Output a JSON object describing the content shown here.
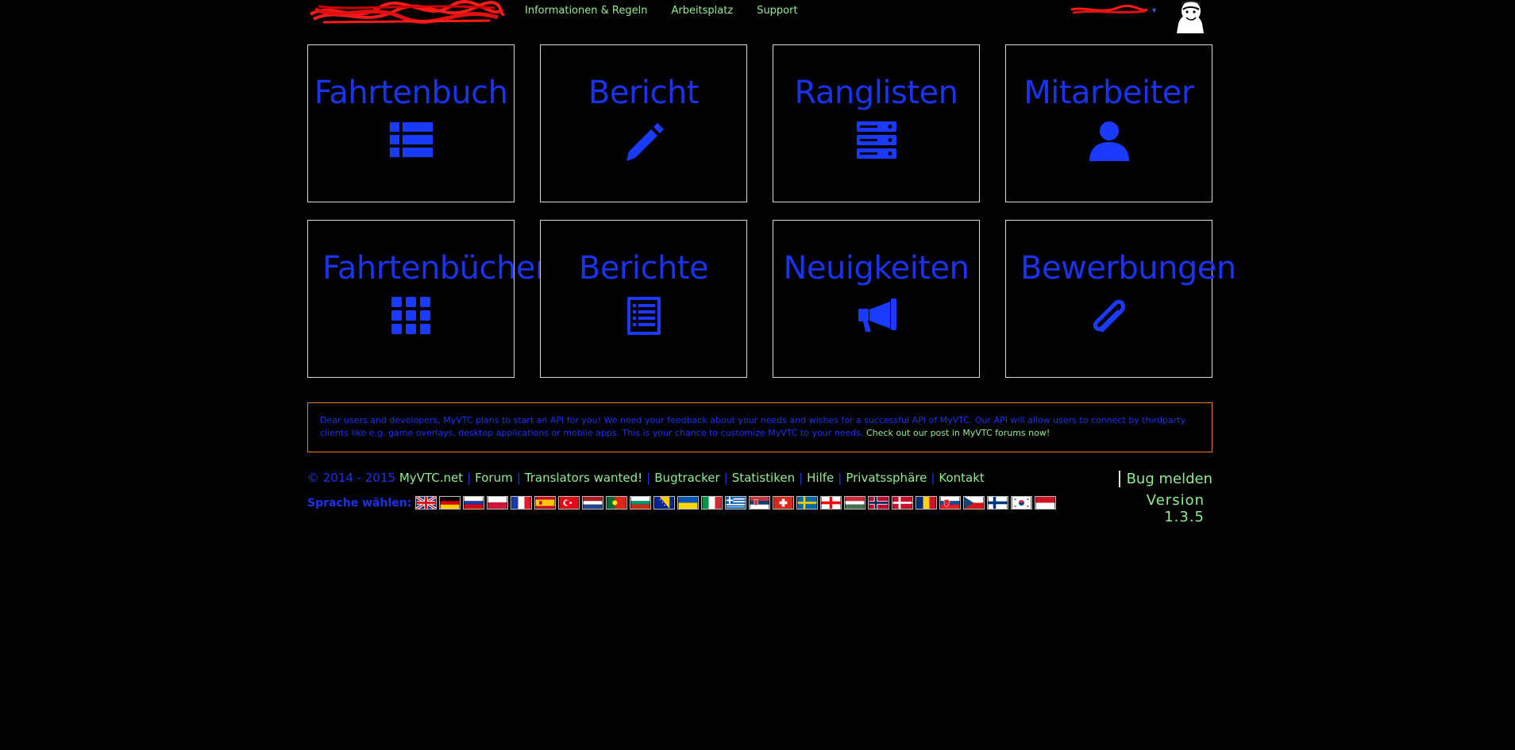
{
  "topnav": {
    "links": [
      "Informationen & Regeln",
      "Arbeitsplatz",
      "Support"
    ],
    "caret": "▾"
  },
  "tiles": [
    {
      "label": "Fahrtenbuch",
      "icon": "list-icon"
    },
    {
      "label": "Bericht",
      "icon": "pencil-icon"
    },
    {
      "label": "Ranglisten",
      "icon": "server-stack-icon"
    },
    {
      "label": "Mitarbeiter",
      "icon": "user-icon"
    },
    {
      "label": "Fahrtenbücher",
      "icon": "grid-icon"
    },
    {
      "label": "Berichte",
      "icon": "document-list-icon"
    },
    {
      "label": "Neuigkeiten",
      "icon": "megaphone-icon"
    },
    {
      "label": "Bewerbungen",
      "icon": "paperclip-icon"
    }
  ],
  "notice": {
    "text": "Dear users and developers, MyVTC plans to start an API for you! We need your feedback about your needs and wishes for a successful API of MyVTC. Our API will allow users to connect by thirdparty clients like e.g. game overlays, desktop applications or mobile apps. This is your chance to customize MyVTC to your needs.",
    "link": "Check out our post in MyVTC forums now!"
  },
  "footer": {
    "copyright": "© 2014 - 2015",
    "links": [
      "MyVTC.net",
      "Forum",
      "Translators wanted!",
      "Bugtracker",
      "Statistiken",
      "Hilfe",
      "Privatssphäre",
      "Kontakt"
    ],
    "separator": "|",
    "language_label": "Sprache wählen:",
    "bug_report": "Bug melden",
    "version": "Version 1.3.5"
  },
  "colors": {
    "tile_text": "#1a33ee",
    "link_green": "#90ee90",
    "notice_border": "#e0802a"
  },
  "flags": [
    "uk-flag-icon",
    "germany-flag-icon",
    "russia-flag-icon",
    "poland-flag-icon",
    "france-flag-icon",
    "spain-flag-icon",
    "turkey-flag-icon",
    "netherlands-flag-icon",
    "portugal-flag-icon",
    "bulgaria-flag-icon",
    "bosnia-flag-icon",
    "ukraine-flag-icon",
    "italy-flag-icon",
    "greece-flag-icon",
    "serbia-flag-icon",
    "switzerland-flag-icon",
    "sweden-flag-icon",
    "georgia-flag-icon",
    "hungary-flag-icon",
    "norway-flag-icon",
    "denmark-flag-icon",
    "romania-flag-icon",
    "slovakia-flag-icon",
    "czech-flag-icon",
    "finland-flag-icon",
    "korea-flag-icon",
    "indonesia-flag-icon"
  ]
}
